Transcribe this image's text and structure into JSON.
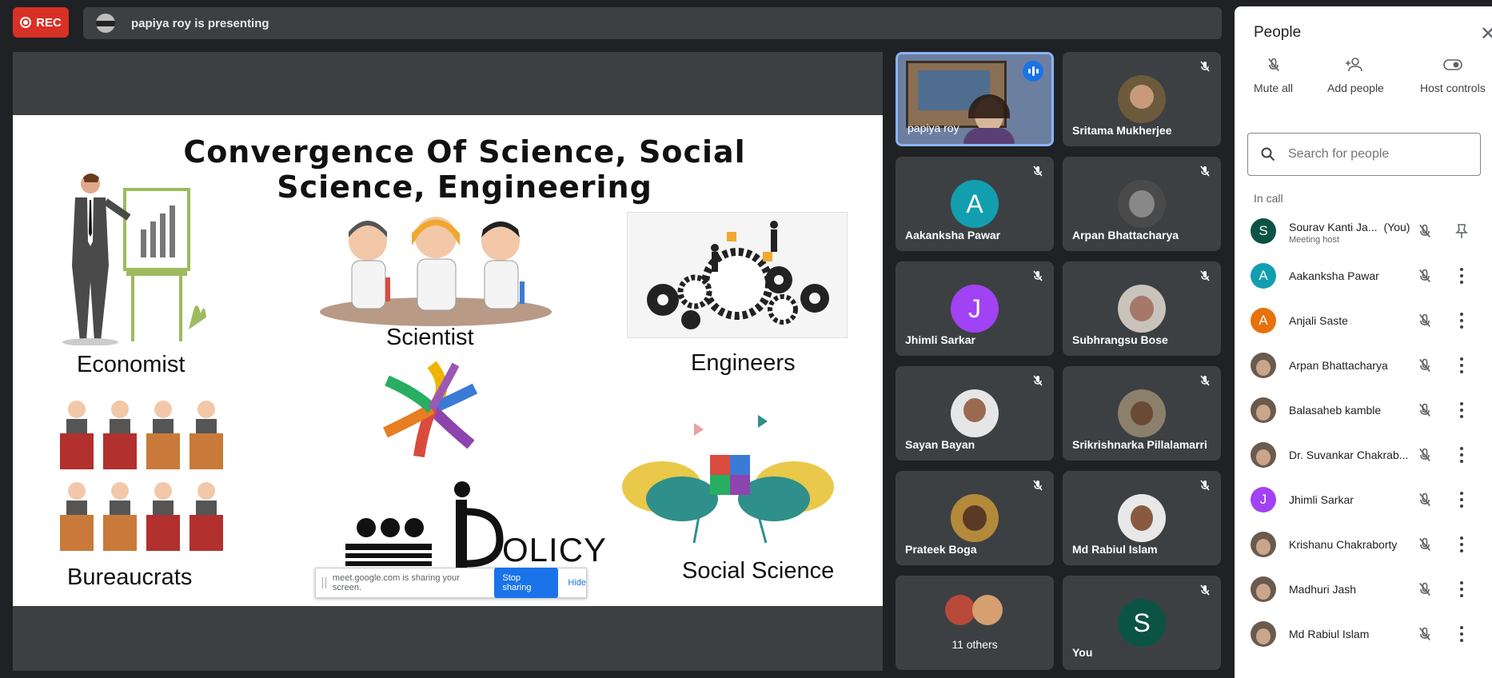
{
  "top_bar": {
    "rec_label": "REC",
    "presenting_text": "papiya roy is presenting"
  },
  "slide": {
    "title": "Convergence Of Science, Social Science, Engineering",
    "captions": {
      "economist": "Economist",
      "scientist": "Scientist",
      "engineers": "Engineers",
      "bureaucrats": "Bureaucrats",
      "social_science": "Social Science",
      "policy": "OLICY"
    }
  },
  "share_bar": {
    "message": "meet.google.com is sharing your screen.",
    "stop_label": "Stop sharing",
    "hide_label": "Hide"
  },
  "tiles": [
    {
      "name": "papiya roy"
    },
    {
      "name": "Sritama Mukherjee"
    },
    {
      "name": "Aakanksha Pawar",
      "initial": "A",
      "color": "#129eaf"
    },
    {
      "name": "Arpan Bhattacharya"
    },
    {
      "name": "Jhimli Sarkar",
      "initial": "J",
      "color": "#a142f4"
    },
    {
      "name": "Subhrangsu Bose"
    },
    {
      "name": "Sayan Bayan"
    },
    {
      "name": "Srikrishnarka Pillalamarri"
    },
    {
      "name": "Prateek Boga"
    },
    {
      "name": "Md Rabiul Islam"
    },
    {
      "name": "11 others"
    },
    {
      "name": "You",
      "initial": "S",
      "color": "#0b5345"
    }
  ],
  "panel": {
    "title": "People",
    "actions": {
      "mute_all": "Mute all",
      "add_people": "Add people",
      "host_controls": "Host controls"
    },
    "search_placeholder": "Search for people",
    "section_label": "In call",
    "participants": [
      {
        "name": "Sourav Kanti Ja...",
        "tag": "(You)",
        "sub": "Meeting host",
        "initial": "S",
        "color": "#0b5345"
      },
      {
        "name": "Aakanksha Pawar",
        "initial": "A",
        "color": "#129eaf"
      },
      {
        "name": "Anjali Saste",
        "initial": "A",
        "color": "#e8710a"
      },
      {
        "name": "Arpan Bhattacharya"
      },
      {
        "name": "Balasaheb kamble"
      },
      {
        "name": "Dr. Suvankar Chakrab..."
      },
      {
        "name": "Jhimli Sarkar",
        "initial": "J",
        "color": "#a142f4"
      },
      {
        "name": "Krishanu Chakraborty"
      },
      {
        "name": "Madhuri Jash"
      },
      {
        "name": "Md Rabiul Islam"
      }
    ]
  }
}
